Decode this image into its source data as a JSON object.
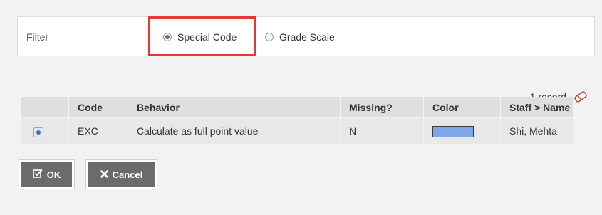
{
  "filter": {
    "label": "Filter",
    "options": [
      {
        "label": "Special Code",
        "selected": true
      },
      {
        "label": "Grade Scale",
        "selected": false
      }
    ]
  },
  "records": {
    "count_label": "1 record"
  },
  "table": {
    "headers": [
      "Code",
      "Behavior",
      "Missing?",
      "Color",
      "Staff > Name"
    ],
    "rows": [
      {
        "code": "EXC",
        "behavior": "Calculate as full point value",
        "missing": "N",
        "color": "#7fa7e8",
        "staff_name": "Shi, Mehta"
      }
    ]
  },
  "buttons": {
    "ok_label": "OK",
    "cancel_label": "Cancel"
  },
  "icons": {
    "ok": "checkbox-check-icon",
    "cancel": "x-icon",
    "records": "eraser-icon"
  }
}
